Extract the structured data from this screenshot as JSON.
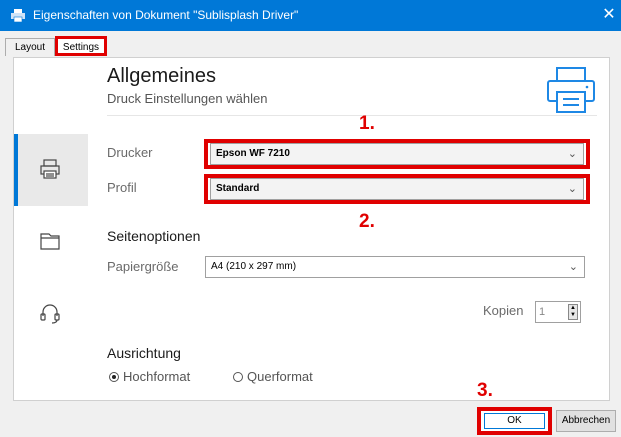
{
  "window": {
    "title": "Eigenschaften von Dokument \"Sublisplash Driver\"",
    "close_glyph": "✕"
  },
  "tabs": [
    {
      "label": "Layout"
    },
    {
      "label": "Settings"
    }
  ],
  "sidebar": {
    "items": [
      {
        "icon": "printer-icon",
        "active": true
      },
      {
        "icon": "page-icon"
      },
      {
        "icon": "headset-icon"
      }
    ]
  },
  "header": {
    "title": "Allgemeines",
    "subtitle": "Druck Einstellungen wählen",
    "icon": "printer-icon"
  },
  "fields": {
    "drucker": {
      "label": "Drucker",
      "value": "Epson WF 7210"
    },
    "profil": {
      "label": "Profil",
      "value": "Standard"
    }
  },
  "page_options": {
    "heading": "Seitenoptionen",
    "paper_label": "Papiergröße",
    "paper_value": "A4 (210 x 297 mm)",
    "copies_label": "Kopien",
    "copies_value": "1"
  },
  "orientation": {
    "heading": "Ausrichtung",
    "options": [
      {
        "label": "Hochformat",
        "selected": true
      },
      {
        "label": "Querformat",
        "selected": false
      }
    ]
  },
  "annotations": {
    "step1": "1.",
    "step2": "2.",
    "step3": "3."
  },
  "buttons": {
    "ok": "OK",
    "cancel": "Abbrechen"
  },
  "colors": {
    "titlebar": "#0078d7",
    "highlight": "#e00000",
    "accent": "#0078d7"
  }
}
